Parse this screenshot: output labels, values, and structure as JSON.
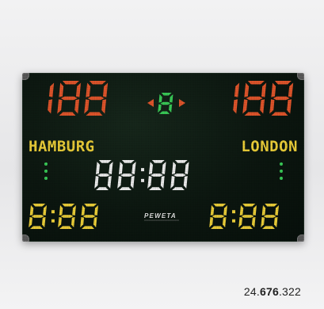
{
  "scoreboard": {
    "home_score": "188",
    "away_score": "188",
    "period": "8",
    "home_team": "HAMBURG",
    "away_team": "LONDON",
    "clock": "88:88",
    "home_penalty": "8:88",
    "away_penalty": "8:88",
    "brand": "PEWETA"
  },
  "caption": {
    "prefix": "24.",
    "bold": "676",
    "suffix": ".322"
  },
  "colors": {
    "score": "#e5572c",
    "period": "#3bd15a",
    "team": "#f2d43a",
    "clock": "#f4f4f4",
    "penalty": "#f2d43a",
    "indicator": "#3bd15a"
  }
}
